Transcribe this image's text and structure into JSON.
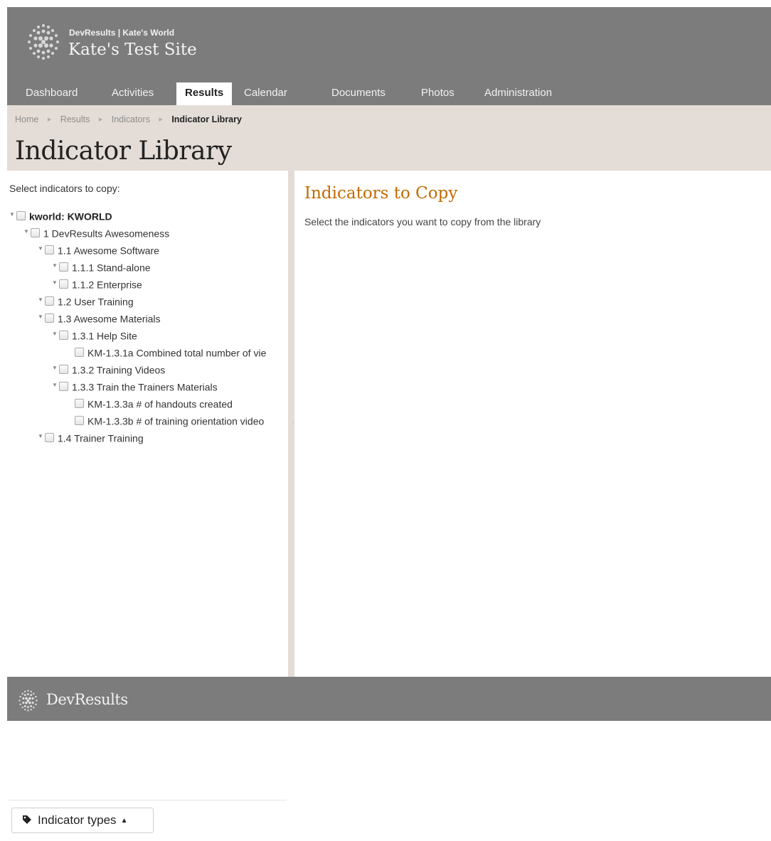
{
  "header": {
    "org_line": "DevResults | Kate's World",
    "site_title": "Kate's Test Site",
    "logo_icon": "globe-dots-icon"
  },
  "nav": {
    "items": [
      {
        "label": "Dashboard",
        "active": false
      },
      {
        "label": "Activities",
        "active": false
      },
      {
        "label": "Results",
        "active": true
      },
      {
        "label": "Calendar",
        "active": false
      },
      {
        "label": "Documents",
        "active": false
      },
      {
        "label": "Photos",
        "active": false
      },
      {
        "label": "Administration",
        "active": false
      }
    ]
  },
  "breadcrumb": {
    "items": [
      "Home",
      "Results",
      "Indicators",
      "Indicator Library"
    ],
    "separator_icon": "triangle-right-icon"
  },
  "page": {
    "title": "Indicator Library"
  },
  "left_pane": {
    "select_label": "Select indicators to copy:",
    "tree": [
      {
        "label": "kworld: KWORLD",
        "level": 0,
        "expanded": true,
        "bold": true
      },
      {
        "label": "1 DevResults Awesomeness",
        "level": 1,
        "expanded": true
      },
      {
        "label": "1.1 Awesome Software",
        "level": 2,
        "expanded": true
      },
      {
        "label": "1.1.1 Stand-alone",
        "level": 3,
        "expanded": true
      },
      {
        "label": "1.1.2 Enterprise",
        "level": 3,
        "expanded": true
      },
      {
        "label": "1.2 User Training",
        "level": 2,
        "expanded": true
      },
      {
        "label": "1.3 Awesome Materials",
        "level": 2,
        "expanded": true
      },
      {
        "label": "1.3.1 Help Site",
        "level": 3,
        "expanded": true
      },
      {
        "label": "KM-1.3.1a Combined total number of vie",
        "level": 4,
        "leaf": true
      },
      {
        "label": "1.3.2 Training Videos",
        "level": 3,
        "expanded": true
      },
      {
        "label": "1.3.3 Train the Trainers Materials",
        "level": 3,
        "expanded": true
      },
      {
        "label": "KM-1.3.3a # of handouts created",
        "level": 4,
        "leaf": true
      },
      {
        "label": "KM-1.3.3b # of training orientation video",
        "level": 4,
        "leaf": true
      },
      {
        "label": "1.4 Trainer Training",
        "level": 2,
        "expanded": true
      }
    ],
    "types_button": {
      "label": "Indicator types",
      "icon": "tag-icon",
      "caret": "▲"
    }
  },
  "right_pane": {
    "title": "Indicators to Copy",
    "description": "Select the indicators you want to copy from the library"
  },
  "footer": {
    "brand": "DevResults",
    "logo_icon": "globe-dots-icon"
  },
  "colors": {
    "header_bg": "#7c7c7c",
    "page_head_bg": "#e4dcd6",
    "accent_title": "#c26b00",
    "footer_bg": "#7c7c7c"
  }
}
